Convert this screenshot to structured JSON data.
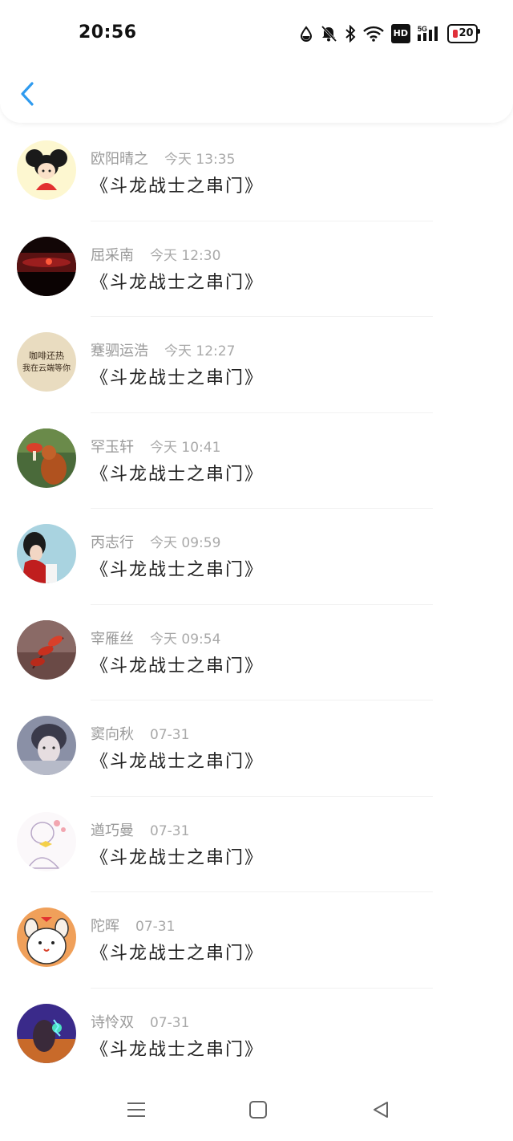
{
  "status_bar": {
    "time": "20:56",
    "icons": [
      "drop-icon",
      "bell-mute-icon",
      "bluetooth-icon",
      "wifi-icon",
      "hd-icon",
      "signal-5g-icon",
      "battery-icon"
    ],
    "hd_label": "HD",
    "network_label": "5G",
    "battery_level": "20",
    "battery_color": "#e0303a"
  },
  "header": {
    "back_icon": "chevron-left-icon",
    "accent_color": "#2f9bef"
  },
  "items": [
    {
      "name": "欧阳晴之",
      "time": "今天 13:35",
      "message": "《斗龙战士之串门》",
      "avatar": "cartoon-girl-avatar"
    },
    {
      "name": "屈采南",
      "time": "今天 12:30",
      "message": "《斗龙战士之串门》",
      "avatar": "sunset-avatar"
    },
    {
      "name": "蹇驷运浩",
      "time": "今天 12:27",
      "message": "《斗龙战士之串门》",
      "avatar": "text-card-avatar",
      "avatar_text_1": "咖啡还热",
      "avatar_text_2": "我在云端等你"
    },
    {
      "name": "罕玉轩",
      "time": "今天 10:41",
      "message": "《斗龙战士之串门》",
      "avatar": "squirrel-avatar"
    },
    {
      "name": "丙志行",
      "time": "今天 09:59",
      "message": "《斗龙战士之串门》",
      "avatar": "girl-photo-avatar"
    },
    {
      "name": "宰雁丝",
      "time": "今天 09:54",
      "message": "《斗龙战士之串门》",
      "avatar": "red-leaves-avatar"
    },
    {
      "name": "窦向秋",
      "time": "07-31",
      "message": "《斗龙战士之串门》",
      "avatar": "portrait-avatar"
    },
    {
      "name": "遒巧曼",
      "time": "07-31",
      "message": "《斗龙战士之串门》",
      "avatar": "sketch-girl-avatar"
    },
    {
      "name": "陀晖",
      "time": "07-31",
      "message": "《斗龙战士之串门》",
      "avatar": "cartoon-dog-avatar"
    },
    {
      "name": "诗怜双",
      "time": "07-31",
      "message": "《斗龙战士之串门》",
      "avatar": "hero-avatar"
    }
  ],
  "nav_bar": {
    "icons": [
      "menu-icon",
      "home-square-icon",
      "back-triangle-icon"
    ]
  }
}
